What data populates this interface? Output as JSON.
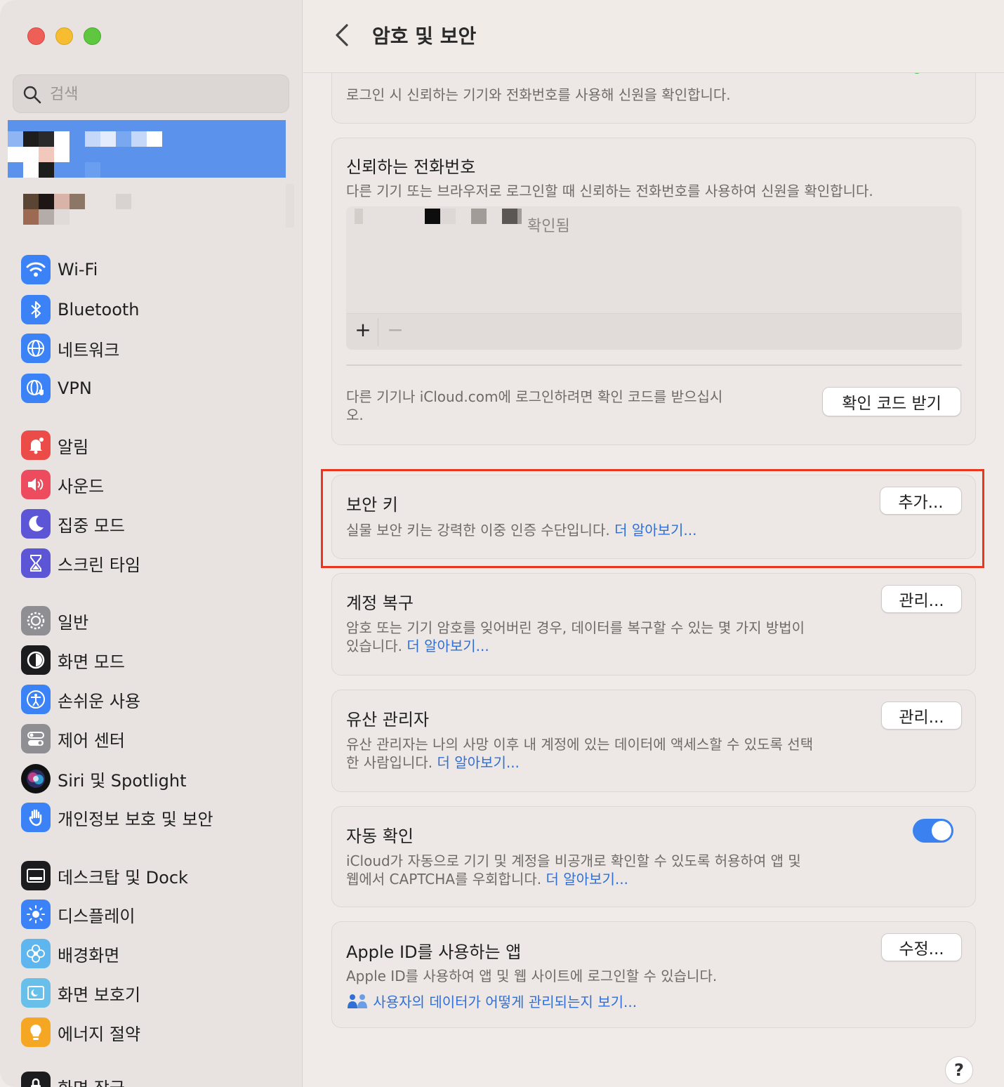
{
  "window": {
    "title": "암호 및 보안"
  },
  "search": {
    "placeholder": "검색"
  },
  "sidebar": {
    "items": [
      {
        "label": "Wi-Fi",
        "icon": "wifi-icon"
      },
      {
        "label": "Bluetooth",
        "icon": "bluetooth-icon"
      },
      {
        "label": "네트워크",
        "icon": "globe-icon"
      },
      {
        "label": "VPN",
        "icon": "vpn-globe-icon"
      },
      {
        "label": "알림",
        "icon": "bell-icon"
      },
      {
        "label": "사운드",
        "icon": "speaker-icon"
      },
      {
        "label": "집중 모드",
        "icon": "moon-icon"
      },
      {
        "label": "스크린 타임",
        "icon": "hourglass-icon"
      },
      {
        "label": "일반",
        "icon": "gear-icon"
      },
      {
        "label": "화면 모드",
        "icon": "appearance-icon"
      },
      {
        "label": "손쉬운 사용",
        "icon": "accessibility-icon"
      },
      {
        "label": "제어 센터",
        "icon": "control-center-icon"
      },
      {
        "label": "Siri 및 Spotlight",
        "icon": "siri-icon"
      },
      {
        "label": "개인정보 보호 및 보안",
        "icon": "hand-icon"
      },
      {
        "label": "데스크탑 및 Dock",
        "icon": "dock-icon"
      },
      {
        "label": "디스플레이",
        "icon": "sun-icon"
      },
      {
        "label": "배경화면",
        "icon": "flower-icon"
      },
      {
        "label": "화면 보호기",
        "icon": "screensaver-icon"
      },
      {
        "label": "에너지 절약",
        "icon": "lightbulb-icon"
      },
      {
        "label": "화면 잠금",
        "icon": "lock-icon"
      }
    ]
  },
  "two_factor": {
    "description": "로그인 시 신뢰하는 기기와 전화번호를 사용해 신원을 확인합니다."
  },
  "trusted_phone": {
    "title": "신뢰하는 전화번호",
    "description": "다른 기기 또는 브라우저로 로그인할 때 신뢰하는 전화번호를 사용하여 신원을 확인합니다.",
    "verified_label": "확인됨",
    "add_label": "+",
    "remove_label": "−",
    "code_text": "다른 기기나 iCloud.com에 로그인하려면 확인 코드를 받으십시오.",
    "code_button": "확인 코드 받기"
  },
  "security_key": {
    "title": "보안 키",
    "description": "실물 보안 키는 강력한 이중 인증 수단입니다.",
    "link": "더 알아보기...",
    "button": "추가..."
  },
  "account_recovery": {
    "title": "계정 복구",
    "description": "암호 또는 기기 암호를 잊어버린 경우, 데이터를 복구할 수 있는 몇 가지 방법이 있습니다.",
    "link": "더 알아보기...",
    "button": "관리..."
  },
  "legacy_contact": {
    "title": "유산 관리자",
    "description": "유산 관리자는 나의 사망 이후 내 계정에 있는 데이터에 액세스할 수 있도록 선택한 사람입니다.",
    "link": "더 알아보기...",
    "button": "관리..."
  },
  "auto_verify": {
    "title": "자동 확인",
    "description": "iCloud가 자동으로 기기 및 계정을 비공개로 확인할 수 있도록 허용하여 앱 및 웹에서 CAPTCHA를 우회합니다.",
    "link": "더 알아보기...",
    "enabled": true
  },
  "apps_using_id": {
    "title": "Apple ID를 사용하는 앱",
    "description": "Apple ID를 사용하여 앱 및 웹 사이트에 로그인할 수 있습니다.",
    "link": "사용자의 데이터가 어떻게 관리되는지 보기...",
    "button": "수정..."
  },
  "help_label": "?",
  "colors": {
    "accent": "#2f6fd6",
    "selection": "#5b93ec",
    "highlight_border": "#e8361f",
    "toggle_on": "#3b82f0"
  }
}
